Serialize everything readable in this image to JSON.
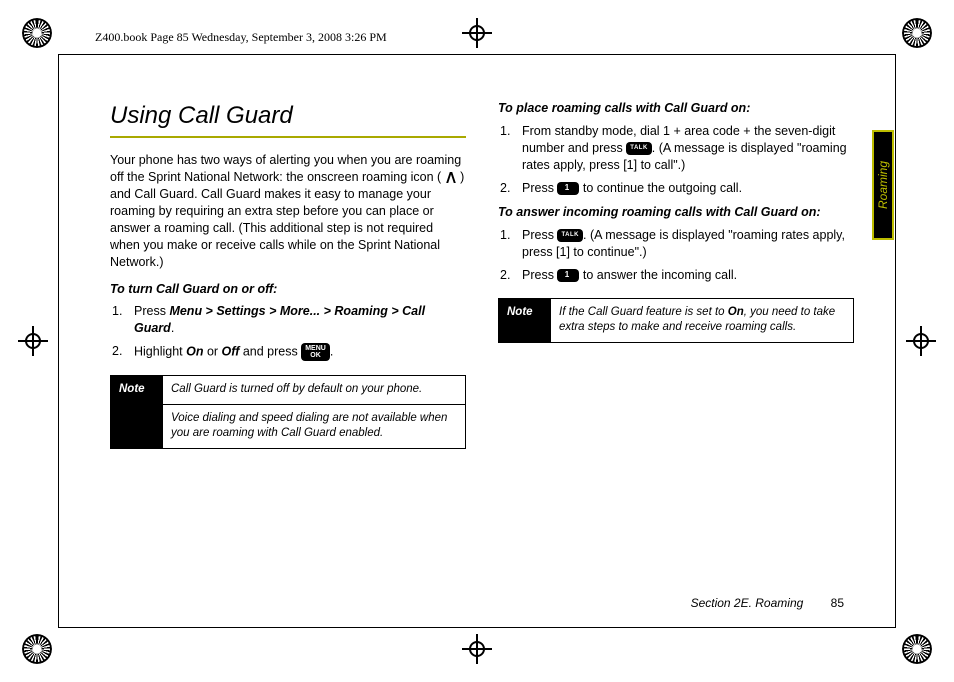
{
  "bookinfo": "Z400.book  Page 85  Wednesday, September 3, 2008  3:26 PM",
  "title": "Using Call Guard",
  "intro": "Your phone has two ways of alerting you when you are roaming off the Sprint National Network: the onscreen roaming icon (      ) and Call Guard. Call Guard makes it easy to manage your roaming by requiring an extra step before you can place or answer a roaming call. (This additional step is not required when you make or receive calls while on the Sprint National Network.)",
  "sub_turn": "To turn Call Guard on or off:",
  "steps_turn": {
    "s1_pre": "Press ",
    "s1_menu": "Menu > Settings > More... > Roaming > Call Guard",
    "s1_post": ".",
    "s2_pre": "Highlight ",
    "s2_on": "On",
    "s2_mid": " or ",
    "s2_off": "Off",
    "s2_post1": " and press ",
    "s2_post2": "."
  },
  "key_menu_line1": "MENU",
  "key_menu_line2": "OK",
  "key_talk": "TALK",
  "key_one_suffix": "",
  "note1_label": "Note",
  "note1_cell1": "Call Guard is turned off by default on your phone.",
  "note1_cell2": "Voice dialing and speed dialing are not available when you are roaming with Call Guard enabled.",
  "sub_place": "To place roaming calls with Call Guard on:",
  "steps_place": {
    "s1_a": "From standby mode, dial 1 + area code + the seven-digit number and press ",
    "s1_b": ". (A message is displayed \"roaming rates apply, press [1] to call\".)",
    "s2_a": "Press ",
    "s2_b": " to continue the outgoing call."
  },
  "sub_answer": "To answer incoming roaming calls with Call Guard on:",
  "steps_answer": {
    "s1_a": "Press ",
    "s1_b": ". (A message is displayed \"roaming rates apply, press [1] to continue\".)",
    "s2_a": "Press ",
    "s2_b": " to answer the incoming call."
  },
  "note2_label": "Note",
  "note2_a": "If the Call Guard feature is set to ",
  "note2_on": "On",
  "note2_b": ", you need to take extra steps to make and receive roaming calls.",
  "sidetab": "Roaming",
  "footer_section": "Section 2E. Roaming",
  "footer_page": "85"
}
